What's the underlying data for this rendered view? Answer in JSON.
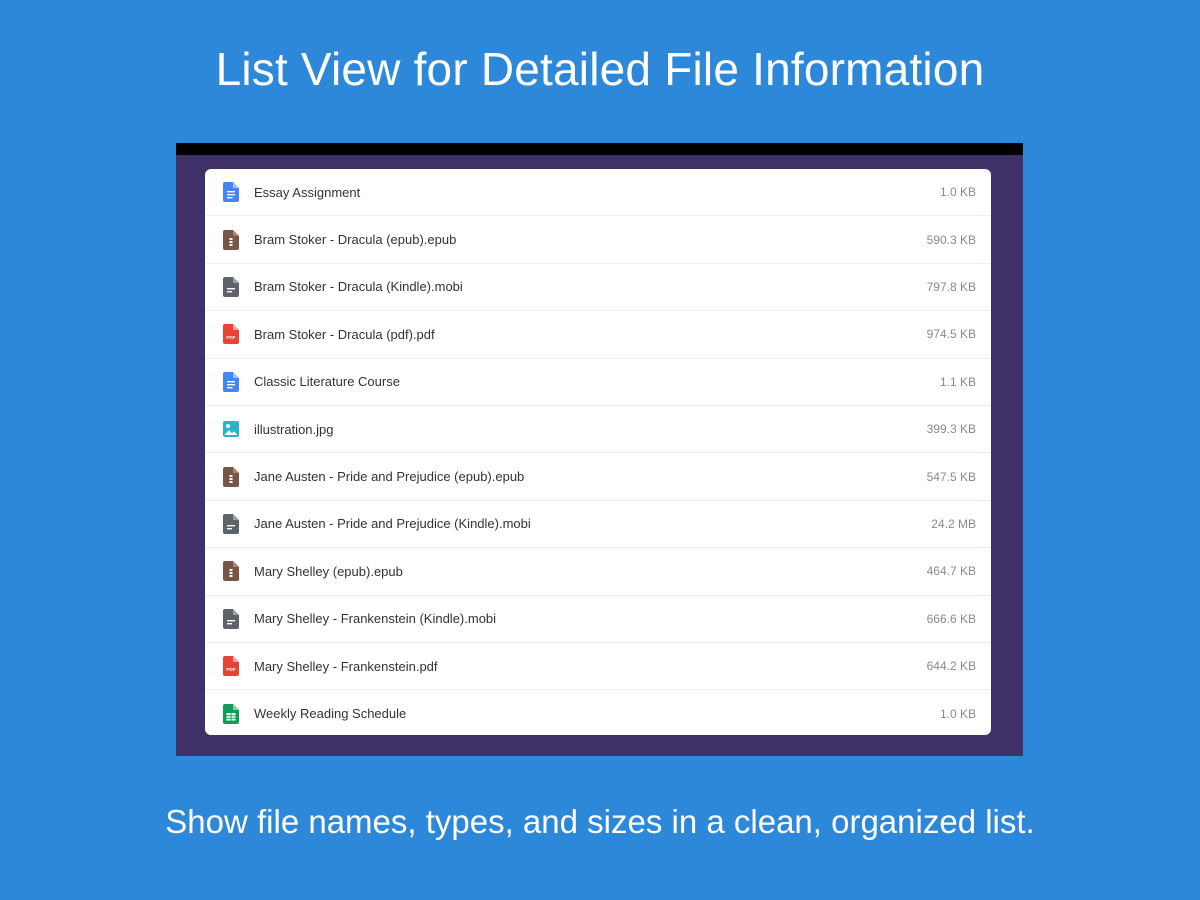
{
  "header": {
    "title": "List View for Detailed File Information"
  },
  "footer": {
    "caption": "Show file names, types, and sizes in a clean, organized list."
  },
  "colors": {
    "background": "#2E88DA",
    "frame": "#3F3168",
    "doc": "#4285F4",
    "epub": "#795548",
    "mobi": "#5F6368",
    "pdf": "#EA4335",
    "image": "#26B5C6",
    "sheet": "#0F9D58"
  },
  "files": [
    {
      "name": "Essay Assignment",
      "size": "1.0 KB",
      "icon": "doc-icon",
      "type": "doc"
    },
    {
      "name": "Bram Stoker - Dracula (epub).epub",
      "size": "590.3 KB",
      "icon": "epub-icon",
      "type": "epub"
    },
    {
      "name": "Bram Stoker - Dracula (Kindle).mobi",
      "size": "797.8 KB",
      "icon": "mobi-icon",
      "type": "mobi"
    },
    {
      "name": "Bram Stoker - Dracula (pdf).pdf",
      "size": "974.5 KB",
      "icon": "pdf-icon",
      "type": "pdf"
    },
    {
      "name": "Classic Literature Course",
      "size": "1.1 KB",
      "icon": "doc-icon",
      "type": "doc"
    },
    {
      "name": "illustration.jpg",
      "size": "399.3 KB",
      "icon": "image-icon",
      "type": "image"
    },
    {
      "name": "Jane Austen - Pride and Prejudice (epub).epub",
      "size": "547.5 KB",
      "icon": "epub-icon",
      "type": "epub"
    },
    {
      "name": "Jane Austen - Pride and Prejudice (Kindle).mobi",
      "size": "24.2 MB",
      "icon": "mobi-icon",
      "type": "mobi"
    },
    {
      "name": "Mary Shelley (epub).epub",
      "size": "464.7 KB",
      "icon": "epub-icon",
      "type": "epub"
    },
    {
      "name": "Mary Shelley - Frankenstein (Kindle).mobi",
      "size": "666.6 KB",
      "icon": "mobi-icon",
      "type": "mobi"
    },
    {
      "name": "Mary Shelley - Frankenstein.pdf",
      "size": "644.2 KB",
      "icon": "pdf-icon",
      "type": "pdf"
    },
    {
      "name": "Weekly Reading Schedule",
      "size": "1.0 KB",
      "icon": "spreadsheet-icon",
      "type": "sheet"
    }
  ]
}
